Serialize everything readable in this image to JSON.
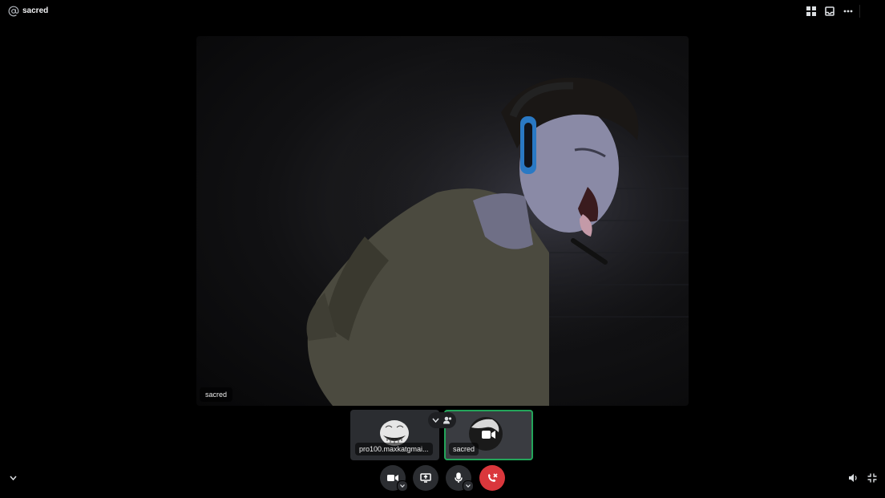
{
  "header": {
    "channel_title": "sacred",
    "icons": [
      "at-icon",
      "grid-icon",
      "inbox-icon",
      "more-icon"
    ]
  },
  "stage": {
    "participant_name": "sacred"
  },
  "tiles": [
    {
      "name": "pro100.maxkatgmai...",
      "avatar": "trollface-avatar"
    },
    {
      "name": "sacred",
      "avatar": "camera-icon",
      "speaking": true
    }
  ],
  "controls": {
    "camera_icon": "camera-icon",
    "share_icon": "screen-share-icon",
    "mic_icon": "microphone-icon",
    "leave_icon": "leave-call-icon"
  },
  "colors": {
    "background": "#000000",
    "button_bg": "#2b2d31",
    "leave_red": "#da373c",
    "speaking_green": "#23a55a"
  }
}
